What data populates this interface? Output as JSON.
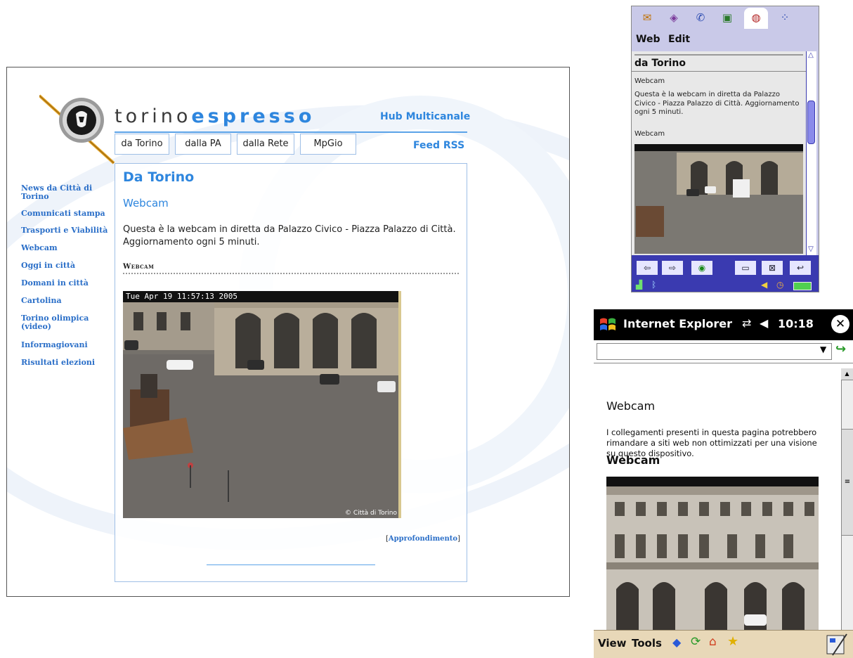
{
  "desktop": {
    "logo_part1": "torino",
    "logo_part2": "espresso",
    "hub": "Hub Multicanale",
    "feed": "Feed RSS",
    "tabs": [
      "da Torino",
      "dalla PA",
      "dalla Rete",
      "MpGio"
    ],
    "nav": [
      "News da Città di Torino",
      "Comunicati stampa",
      "Trasporti e Viabilità",
      "Webcam",
      "Oggi in città",
      "Domani in città",
      "Cartolina",
      "Torino olimpica (video)",
      "Informagiovani",
      "Risultati elezioni"
    ],
    "page_title": "Da Torino",
    "section_title": "Webcam",
    "description": "Questa è la webcam in diretta da Palazzo Civico - Piazza Palazzo di Città. Aggiornamento ogni 5 minuti.",
    "webcam_heading": "Webcam",
    "cam_timestamp": "Tue Apr 19 11:57:13 2005",
    "cam_credit": "© Città di Torino",
    "more_bracket_open": "[",
    "more_link": "Approfondimento",
    "more_bracket_close": "]"
  },
  "phone1": {
    "menu": [
      "Web",
      "Edit"
    ],
    "title": "da Torino",
    "label1": "Webcam",
    "description": "Questa è la webcam in diretta da Palazzo Civico - Piazza Palazzo di Città. Aggiornamento ogni 5 minuti.",
    "label2": "Webcam",
    "icons": [
      "mail-icon",
      "book-icon",
      "phone-icon",
      "calendar-icon",
      "browser-icon",
      "apps-icon"
    ],
    "colors": {
      "frame": "#c9c9e8",
      "toolbar": "#3a3ab0"
    }
  },
  "phone2": {
    "app_title": "Internet Explorer",
    "time": "10:18",
    "heading1": "Webcam",
    "notice": "I collegamenti presenti in questa pagina potrebbero rimandare a siti web non ottimizzati per una visione su questo dispositivo.",
    "heading2": "Webcam",
    "menu": [
      "View",
      "Tools"
    ],
    "colors": {
      "titlebar": "#000000",
      "menubar": "#e8d8b8"
    }
  }
}
